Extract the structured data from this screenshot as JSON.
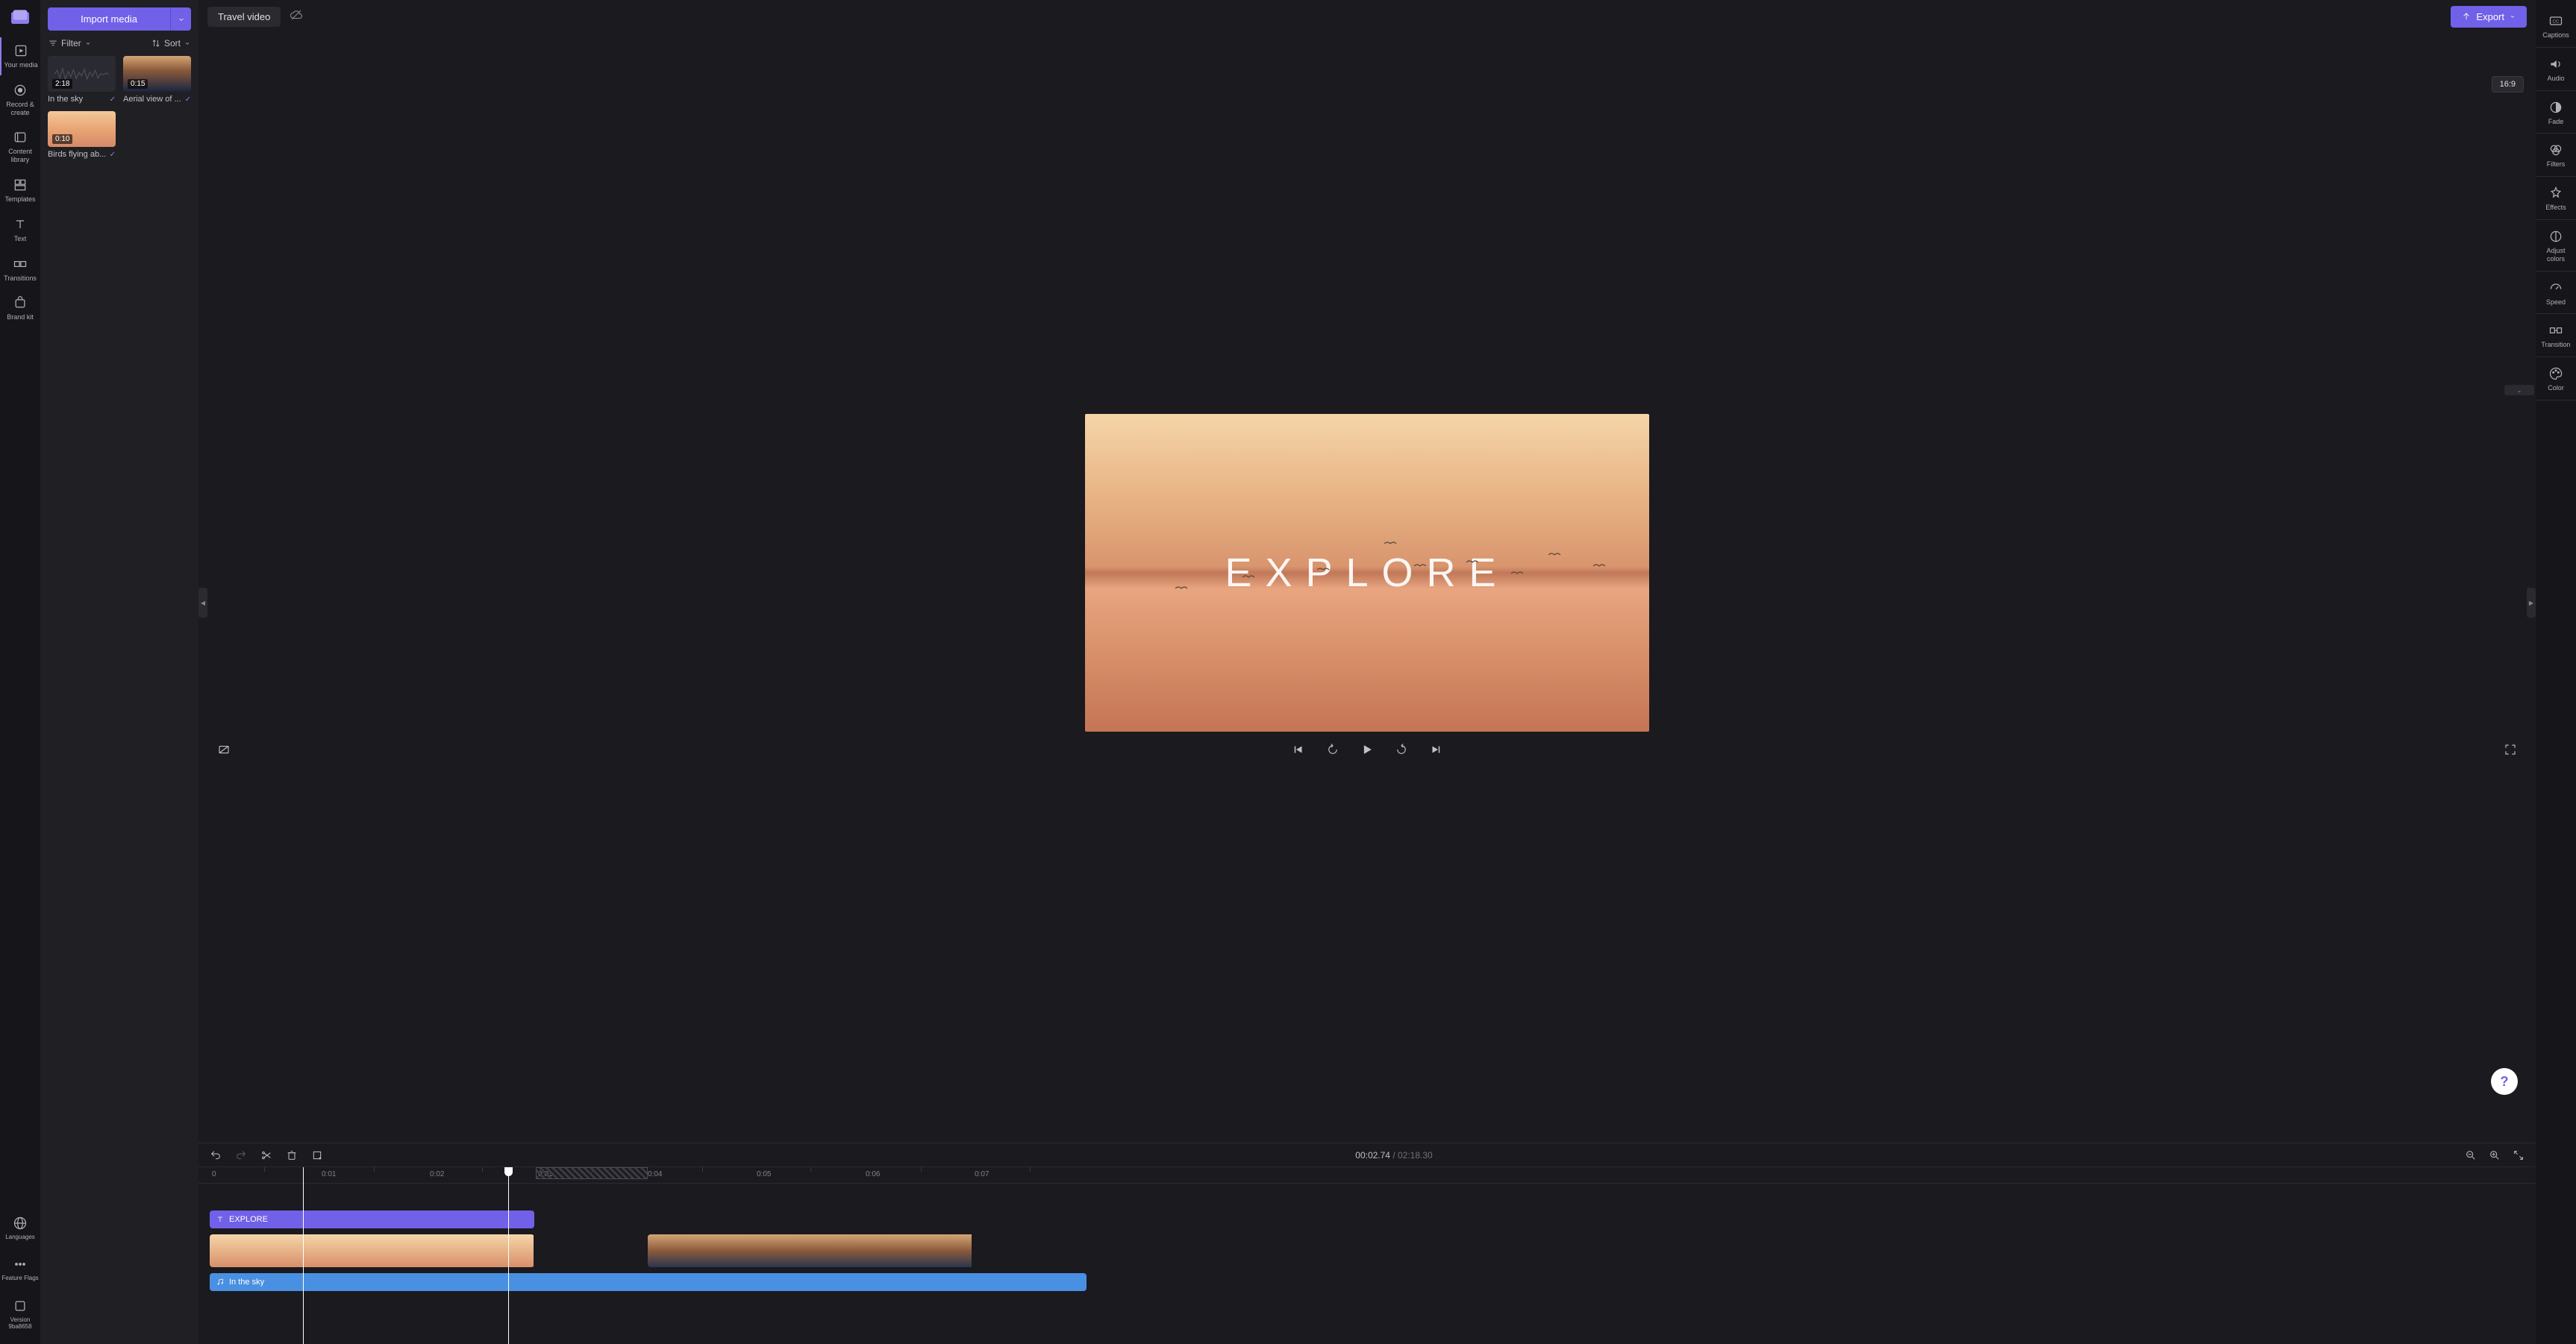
{
  "project": {
    "title": "Travel video"
  },
  "left_rail": [
    {
      "id": "your-media",
      "label": "Your media"
    },
    {
      "id": "record-create",
      "label": "Record & create"
    },
    {
      "id": "content-library",
      "label": "Content library"
    },
    {
      "id": "templates",
      "label": "Templates"
    },
    {
      "id": "text",
      "label": "Text"
    },
    {
      "id": "transitions",
      "label": "Transitions"
    },
    {
      "id": "brand-kit",
      "label": "Brand kit"
    }
  ],
  "left_rail_bottom": [
    {
      "id": "languages",
      "label": "Languages"
    },
    {
      "id": "feature-flags",
      "label": "Feature Flags"
    },
    {
      "id": "version",
      "label": "Version 9ba8658"
    }
  ],
  "media_panel": {
    "import_label": "Import media",
    "filter_label": "Filter",
    "sort_label": "Sort",
    "items": [
      {
        "name": "In the sky",
        "duration": "2:18",
        "kind": "audio"
      },
      {
        "name": "Aerial view of ...",
        "duration": "0:15",
        "kind": "mountain"
      },
      {
        "name": "Birds flying ab...",
        "duration": "0:10",
        "kind": "birds"
      }
    ]
  },
  "export_label": "Export",
  "aspect_ratio": "16:9",
  "canvas_text": "EXPLORE",
  "time": {
    "current": "00:02.74",
    "total": "02:18.30",
    "sep": " / "
  },
  "ruler_ticks": [
    "0",
    "0:01",
    "0:02",
    "0:03",
    "0:04",
    "0:05",
    "0:06",
    "0:07"
  ],
  "tracks": {
    "text_clip_label": "EXPLORE",
    "audio_clip_label": "In the sky"
  },
  "right_rail": [
    {
      "id": "captions",
      "label": "Captions"
    },
    {
      "id": "audio",
      "label": "Audio"
    },
    {
      "id": "fade",
      "label": "Fade"
    },
    {
      "id": "filters",
      "label": "Filters"
    },
    {
      "id": "effects",
      "label": "Effects"
    },
    {
      "id": "adjust-colors",
      "label": "Adjust colors"
    },
    {
      "id": "speed",
      "label": "Speed"
    },
    {
      "id": "transition",
      "label": "Transition"
    },
    {
      "id": "color",
      "label": "Color"
    }
  ],
  "help_tooltip": "?"
}
